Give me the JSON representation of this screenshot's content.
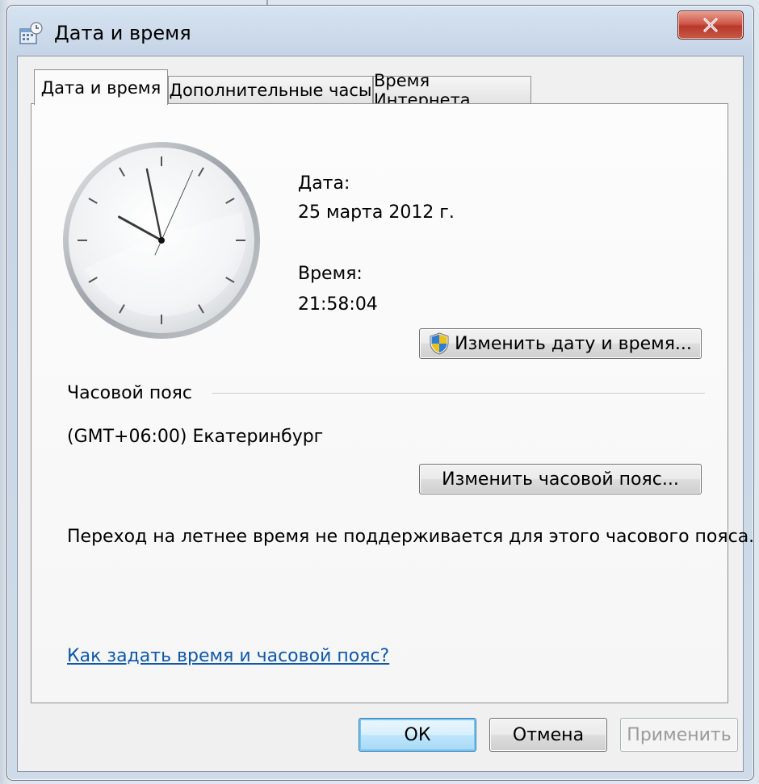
{
  "window": {
    "title": "Дата и время",
    "title_icon": "date-time-icon",
    "close_icon": "close-icon"
  },
  "tabs": [
    {
      "label": "Дата и время",
      "active": true
    },
    {
      "label": "Дополнительные часы",
      "active": false
    },
    {
      "label": "Время Интернета",
      "active": false
    }
  ],
  "clock": {
    "time": "21:58:04"
  },
  "date_section": {
    "date_label": "Дата:",
    "date_value": "25 марта 2012 г.",
    "time_label": "Время:",
    "time_value": "21:58:04",
    "change_button": "Изменить дату и время...",
    "change_button_icon": "uac-shield-icon"
  },
  "timezone": {
    "heading": "Часовой пояс",
    "value": "(GMT+06:00) Екатеринбург",
    "change_button": "Изменить часовой пояс...",
    "dst_note": "Переход на летнее время не поддерживается для этого часового пояса."
  },
  "help_link": "Как задать время и часовой пояс?",
  "footer": {
    "ok": "ОК",
    "cancel": "Отмена",
    "apply": "Применить",
    "apply_disabled": true
  },
  "colors": {
    "link": "#0f58a8",
    "close_button": "#c8463a",
    "default_button_border": "#3c7fb1"
  }
}
